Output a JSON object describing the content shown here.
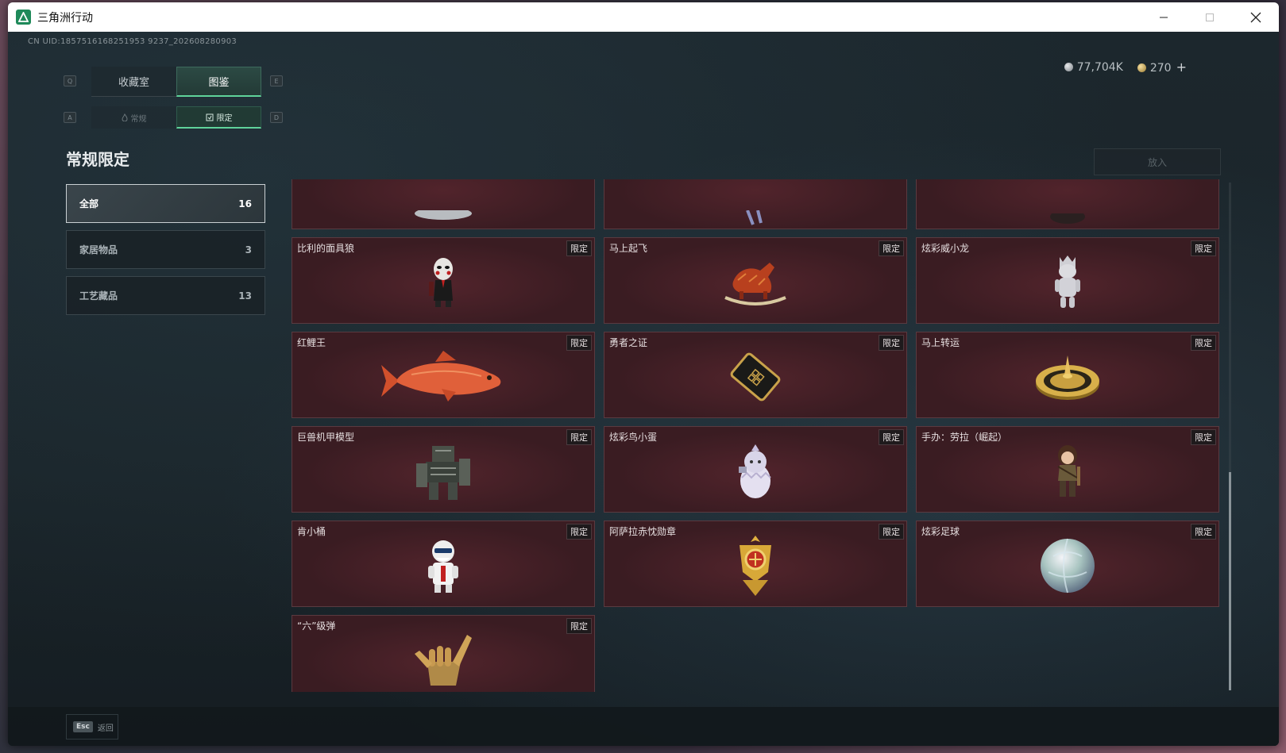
{
  "window": {
    "title": "三角洲行动"
  },
  "header": {
    "uid": "CN UID:1857516168251953 9237_202608280903",
    "silver_amount": "77,704K",
    "gold_amount": "270",
    "plus_symbol": "+"
  },
  "key_hints": {
    "left_main": "Q",
    "right_main": "E",
    "left_sub": "A",
    "right_sub": "D"
  },
  "main_tabs": [
    {
      "label": "收藏室",
      "active": false
    },
    {
      "label": "图鉴",
      "active": true
    }
  ],
  "sub_tabs": [
    {
      "label": "常规",
      "active": false
    },
    {
      "label": "限定",
      "active": true
    }
  ],
  "section_title": "常规限定",
  "put_button_label": "放入",
  "categories": [
    {
      "label": "全部",
      "count": "16",
      "active": true
    },
    {
      "label": "家居物品",
      "count": "3",
      "active": false
    },
    {
      "label": "工艺藏品",
      "count": "13",
      "active": false
    }
  ],
  "badge_label": "限定",
  "items": [
    {
      "name": "比利的面具狼",
      "icon": "mask-puppet-figure-icon"
    },
    {
      "name": "马上起飞",
      "icon": "red-rocking-horse-icon"
    },
    {
      "name": "炫彩威小龙",
      "icon": "silver-dragon-figure-icon"
    },
    {
      "name": "红鲤王",
      "icon": "red-carp-fish-icon"
    },
    {
      "name": "勇者之证",
      "icon": "black-gold-card-icon"
    },
    {
      "name": "马上转运",
      "icon": "golden-roulette-icon"
    },
    {
      "name": "巨兽机甲模型",
      "icon": "mech-model-icon"
    },
    {
      "name": "炫彩鸟小蛋",
      "icon": "egg-bird-figure-icon"
    },
    {
      "name": "手办：劳拉（崛起）",
      "icon": "lara-figure-icon"
    },
    {
      "name": "肯小桶",
      "icon": "colonel-figure-icon"
    },
    {
      "name": "阿萨拉赤忱勋章",
      "icon": "gold-medal-icon"
    },
    {
      "name": "炫彩足球",
      "icon": "iridescent-ball-icon"
    },
    {
      "name": "“六”级弹",
      "icon": "golden-hand-gesture-icon"
    }
  ],
  "footer": {
    "esc_key": "Esc",
    "esc_label": "返回"
  },
  "colors": {
    "accent": "#5fd39a",
    "card_bg": "#3a1c22",
    "panel_bg": "#1a2329"
  }
}
